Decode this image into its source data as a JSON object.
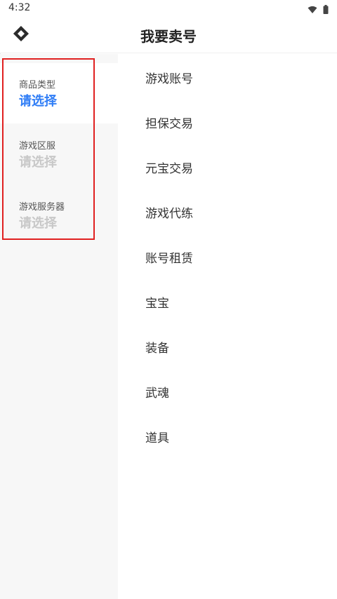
{
  "status_bar": {
    "time": "4:32",
    "icons": [
      "wifi-icon",
      "battery-icon"
    ]
  },
  "header": {
    "title": "我要卖号",
    "back_icon": "diamond-logo-icon"
  },
  "filters": [
    {
      "label": "商品类型",
      "value": "请选择",
      "active": true
    },
    {
      "label": "游戏区服",
      "value": "请选择",
      "active": false
    },
    {
      "label": "游戏服务器",
      "value": "请选择",
      "active": false
    }
  ],
  "options": [
    "游戏账号",
    "担保交易",
    "元宝交易",
    "游戏代练",
    "账号租赁",
    "宝宝",
    "装备",
    "武魂",
    "道具"
  ],
  "colors": {
    "accent": "#2f7df6",
    "highlight": "#e02020",
    "sidebar_bg": "#f7f7f7",
    "placeholder": "#c8c8c8"
  }
}
